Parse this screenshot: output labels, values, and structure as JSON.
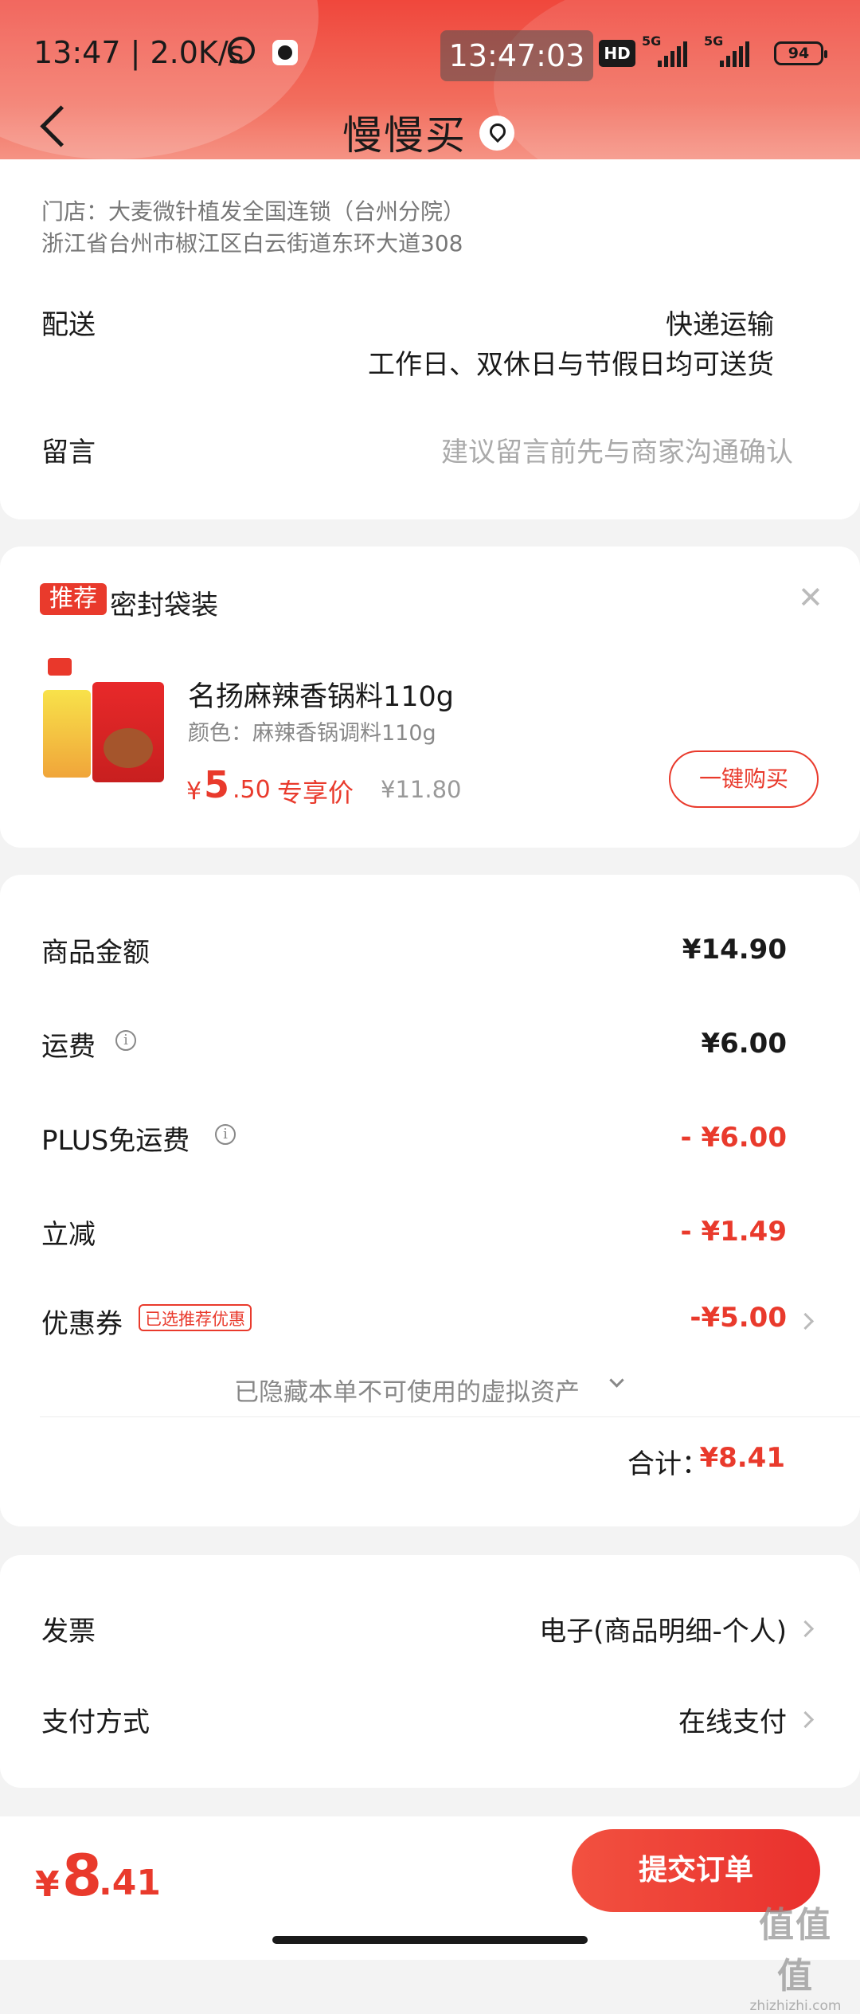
{
  "status_bar": {
    "time_speed": "13:47 | 2.0K/s",
    "clock": "13:47:03",
    "hd": "HD",
    "net1": "5G",
    "net2": "5G",
    "battery": "94"
  },
  "header": {
    "title": "慢慢买"
  },
  "store": {
    "name": "门店：大麦微针植发全国连锁（台州分院）",
    "address": "浙江省台州市椒江区白云街道东环大道308"
  },
  "delivery": {
    "label": "配送",
    "method": "快递运输",
    "note": "工作日、双休日与节假日均可送货"
  },
  "message": {
    "label": "留言",
    "placeholder": "建议留言前先与商家沟通确认"
  },
  "recommend": {
    "tag": "推荐",
    "title": "密封袋装",
    "product_name": "名扬麻辣香锅料110g",
    "spec": "颜色：麻辣香锅调料110g",
    "price_symbol": "¥",
    "price_int": "5",
    "price_dec": ".50",
    "price_label": "专享价",
    "original_price": "¥11.80",
    "buy_label": "一键购买"
  },
  "summary": {
    "goods_label": "商品金额",
    "goods_value": "¥14.90",
    "shipping_label": "运费",
    "shipping_value": "¥6.00",
    "plus_label": "PLUS免运费",
    "plus_value": "- ¥6.00",
    "discount_label": "立减",
    "discount_value": "- ¥1.49",
    "coupon_label": "优惠券",
    "coupon_badge": "已选推荐优惠",
    "coupon_value": "-¥5.00",
    "hidden_note": "已隐藏本单不可使用的虚拟资产",
    "total_label": "合计：",
    "total_value": "¥8.41"
  },
  "invoice": {
    "label": "发票",
    "value": "电子(商品明细-个人)"
  },
  "payment": {
    "label": "支付方式",
    "value": "在线支付"
  },
  "bottom": {
    "price_symbol": "¥",
    "price_int": "8",
    "price_dec": ".41",
    "submit_label": "提交订单"
  },
  "watermark": {
    "big": "值值值",
    "small": "zhizhizhi.com"
  },
  "colors": {
    "accent": "#e93a2c",
    "header_top": "#f0473c",
    "header_bottom": "#f7a597"
  }
}
